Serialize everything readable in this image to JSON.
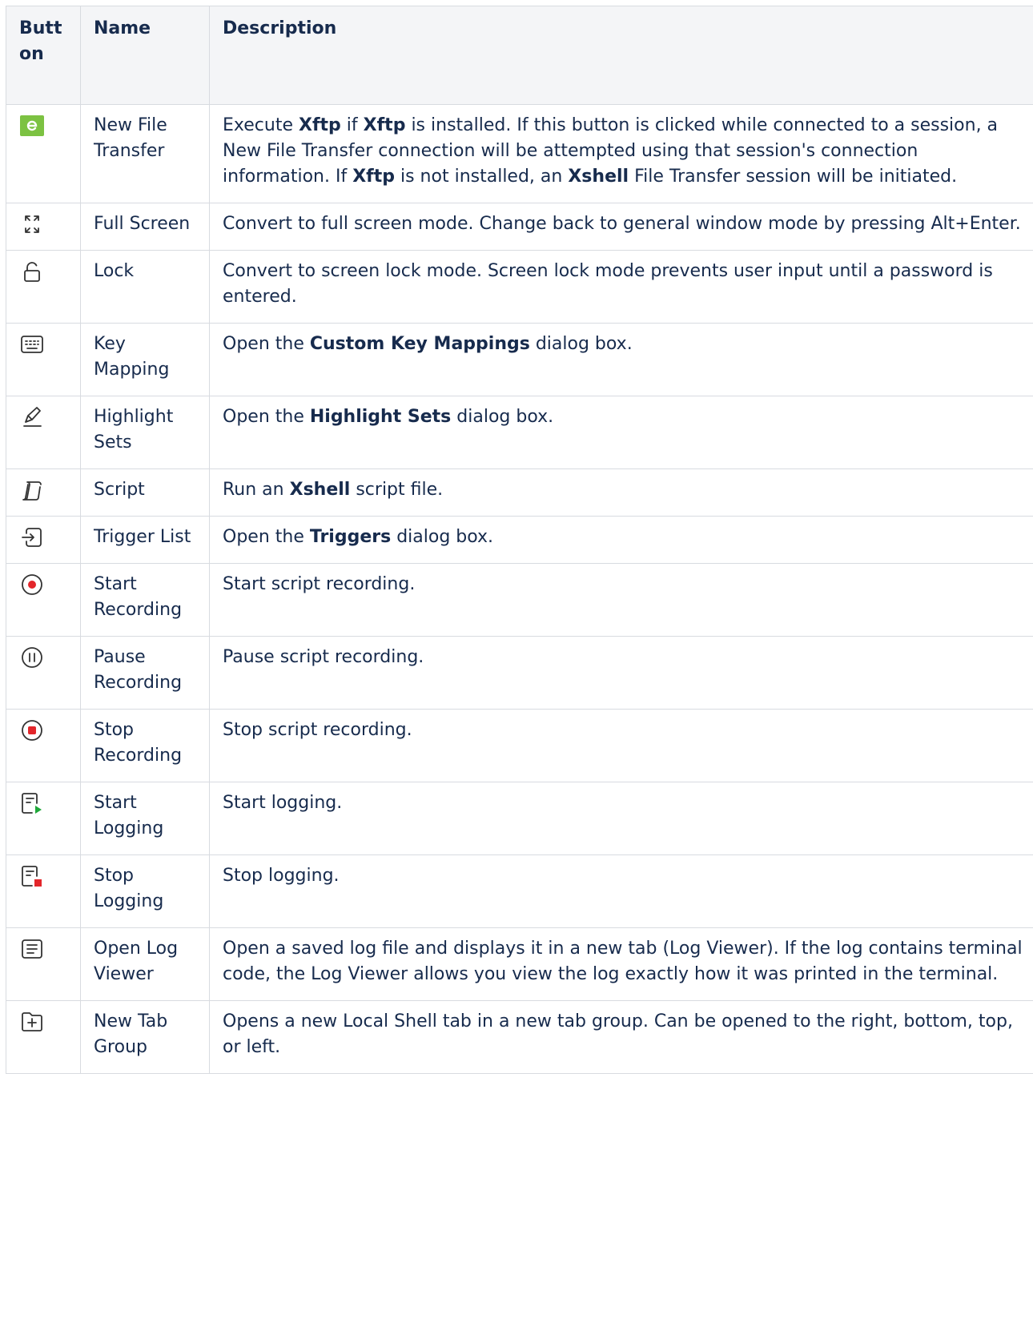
{
  "table": {
    "headers": {
      "button": "Button",
      "name": "Name",
      "description": "Description"
    },
    "rows": [
      {
        "icon": "new-file-transfer-icon",
        "name": "New File Transfer",
        "description": [
          {
            "t": "Execute "
          },
          {
            "t": "Xftp",
            "b": true
          },
          {
            "t": " if "
          },
          {
            "t": "Xftp",
            "b": true
          },
          {
            "t": " is installed. If this button is clicked while connected to a session, a New File Transfer connection will be attempted using that session's connection information. If "
          },
          {
            "t": "Xftp",
            "b": true
          },
          {
            "t": " is not installed, an "
          },
          {
            "t": "Xshell",
            "b": true
          },
          {
            "t": " File Transfer session will be initiated."
          }
        ]
      },
      {
        "icon": "full-screen-icon",
        "name": "Full Screen",
        "description": [
          {
            "t": "Convert to full screen mode. Change back to general window mode by pressing Alt+Enter."
          }
        ]
      },
      {
        "icon": "lock-icon",
        "name": "Lock",
        "description": [
          {
            "t": "Convert to screen lock mode. Screen lock mode prevents user input until a password is entered."
          }
        ]
      },
      {
        "icon": "keyboard-icon",
        "name": "Key Mapping",
        "description": [
          {
            "t": "Open the "
          },
          {
            "t": "Custom Key Mappings",
            "b": true
          },
          {
            "t": " dialog box."
          }
        ]
      },
      {
        "icon": "highlight-pen-icon",
        "name": "Highlight Sets",
        "description": [
          {
            "t": "Open the "
          },
          {
            "t": "Highlight Sets",
            "b": true
          },
          {
            "t": " dialog box."
          }
        ]
      },
      {
        "icon": "script-scroll-icon",
        "name": "Script",
        "description": [
          {
            "t": "Run an "
          },
          {
            "t": "Xshell",
            "b": true
          },
          {
            "t": " script file."
          }
        ]
      },
      {
        "icon": "trigger-list-icon",
        "name": "Trigger List",
        "description": [
          {
            "t": "Open the "
          },
          {
            "t": "Triggers",
            "b": true
          },
          {
            "t": " dialog box."
          }
        ]
      },
      {
        "icon": "start-recording-icon",
        "name": "Start Recording",
        "description": [
          {
            "t": "Start script recording."
          }
        ]
      },
      {
        "icon": "pause-recording-icon",
        "name": "Pause Recording",
        "description": [
          {
            "t": "Pause script recording."
          }
        ]
      },
      {
        "icon": "stop-recording-icon",
        "name": "Stop Recording",
        "description": [
          {
            "t": "Stop script recording."
          }
        ]
      },
      {
        "icon": "start-logging-icon",
        "name": "Start Logging",
        "description": [
          {
            "t": "Start logging."
          }
        ]
      },
      {
        "icon": "stop-logging-icon",
        "name": "Stop Logging",
        "description": [
          {
            "t": "Stop logging."
          }
        ]
      },
      {
        "icon": "open-log-viewer-icon",
        "name": "Open Log Viewer",
        "description": [
          {
            "t": "Open a saved log file and displays it in a new tab (Log Viewer). If the log contains terminal code, the Log Viewer allows you view the log exactly how it was printed in the terminal."
          }
        ]
      },
      {
        "icon": "new-tab-group-icon",
        "name": "New Tab Group",
        "description": [
          {
            "t": "Opens a new Local Shell tab in a new tab group. Can be opened to the right, bottom, top, or left."
          }
        ]
      }
    ]
  },
  "colors": {
    "header_bg": "#f4f5f7",
    "border": "#d8dbe0",
    "text": "#172b4d",
    "xftp_green": "#7cc242",
    "record_red": "#e3262b",
    "play_green": "#1fa83a"
  }
}
